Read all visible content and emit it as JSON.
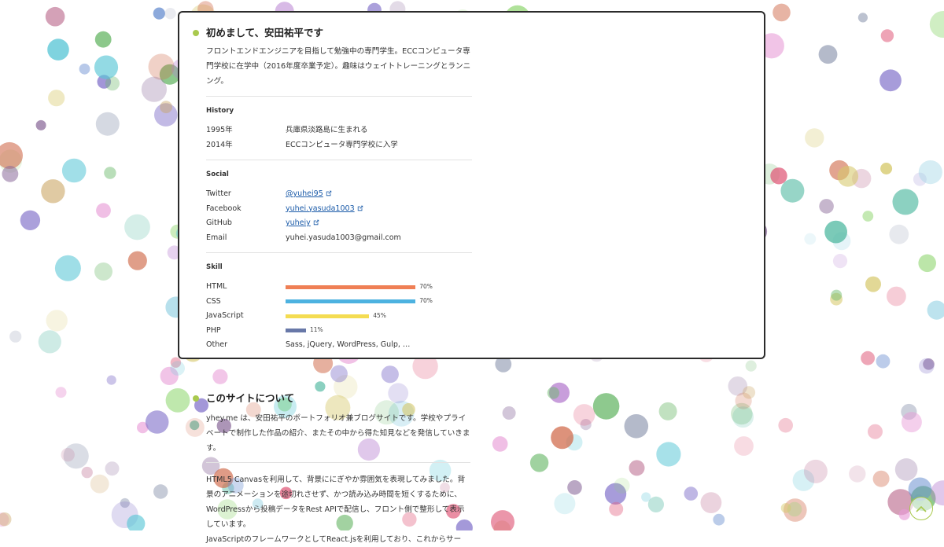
{
  "intro": {
    "title": "初めまして、安田祐平です",
    "description": "フロントエンドエンジニアを目指して勉強中の専門学生。ECCコンピュータ専門学校に在学中（2016年度卒業予定）。趣味はウェイトトレーニングとランニング。"
  },
  "history": {
    "heading": "History",
    "items": [
      {
        "year": "1995年",
        "text": "兵庫県淡路島に生まれる"
      },
      {
        "year": "2014年",
        "text": "ECCコンピュータ専門学校に入学"
      }
    ]
  },
  "social": {
    "heading": "Social",
    "items": [
      {
        "name": "Twitter",
        "value": "@yuhei95",
        "link": true,
        "icon": "external-link-icon"
      },
      {
        "name": "Facebook",
        "value": "yuhei.yasuda1003",
        "link": true,
        "icon": "external-link-icon"
      },
      {
        "name": "GitHub",
        "value": "yuheiy",
        "link": true,
        "icon": "external-link-icon"
      },
      {
        "name": "Email",
        "value": "yuhei.yasuda1003@gmail.com",
        "link": false
      }
    ]
  },
  "skill": {
    "heading": "Skill",
    "items": [
      {
        "name": "HTML",
        "percent": 70,
        "label": "70%",
        "color": "#ef7f55"
      },
      {
        "name": "CSS",
        "percent": 70,
        "label": "70%",
        "color": "#4db2e0"
      },
      {
        "name": "JavaScript",
        "percent": 45,
        "label": "45%",
        "color": "#f4dc52"
      },
      {
        "name": "PHP",
        "percent": 11,
        "label": "11%",
        "color": "#6878a8"
      }
    ],
    "other": {
      "name": "Other",
      "value": "Sass, jQuery, WordPress, Gulp, …"
    }
  },
  "about": {
    "title": "このサイトについて",
    "p1": "yhey.me は、安田祐平のポートフォリオ兼ブログサイトです。学校やプライベートで制作した作品の紹介、またその中から得た知見などを発信していきます。",
    "p2": "HTML5 Canvasを利用して、背景ににぎやか雰囲気を表現してみました。背景のアニメーションを途切れさせず、かつ読み込み時間を短くするために、WordPressから投稿データをRest APIで配信し、フロント側で整形して表示しています。",
    "p3": "JavaScriptのフレームワークとしてReact.jsを利用しており、これからサー"
  },
  "back_to_top": {
    "icon": "chevron-up-icon"
  },
  "colors": {
    "accent": "#a9c94e",
    "link": "#1a5aa8",
    "border": "#2b2b2b"
  }
}
